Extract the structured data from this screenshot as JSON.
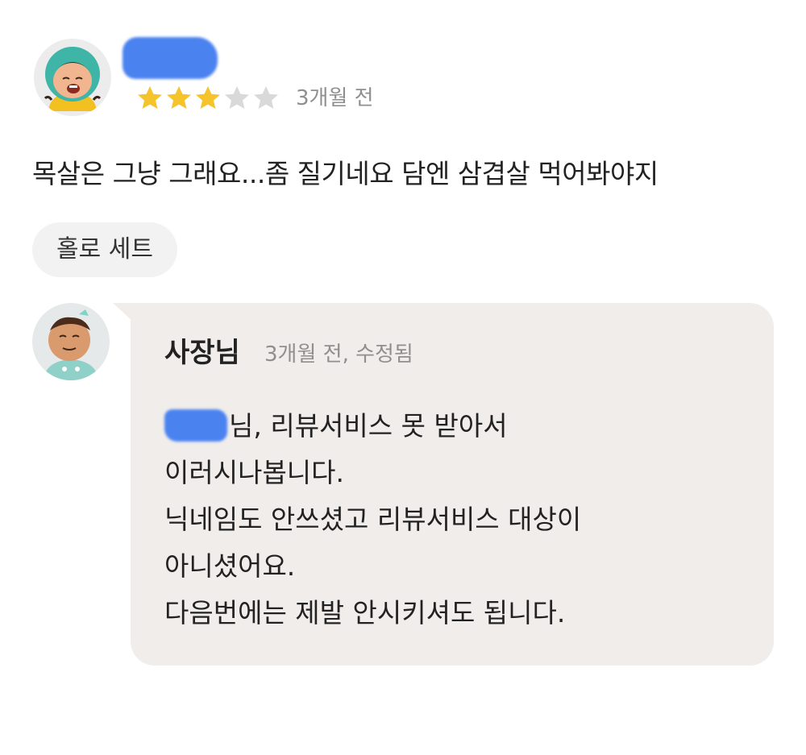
{
  "review": {
    "avatar_icon": "reviewer-avatar",
    "rating": 3,
    "rating_max": 5,
    "date": "3개월 전",
    "text": "목살은 그냥 그래요...좀 질기네요 담엔 삼겹살 먹어봐야지",
    "menu_tag": "홀로 세트"
  },
  "reply": {
    "avatar_icon": "owner-avatar",
    "author": "사장님",
    "meta": "3개월 전, 수정됨",
    "lines": [
      "님, 리뷰서비스 못 받아서",
      "이러시나봅니다.",
      "닉네임도 안쓰셨고 리뷰서비스 대상이",
      "아니셨어요.",
      "다음번에는 제발 안시키셔도 됩니다."
    ]
  },
  "colors": {
    "star_filled": "#f5c42c",
    "star_empty": "#d9d9d9",
    "redaction": "#4a82f0",
    "bubble_bg": "#f0edeb",
    "chip_bg": "#f2f2f2",
    "meta_text": "#8f8f8f"
  }
}
